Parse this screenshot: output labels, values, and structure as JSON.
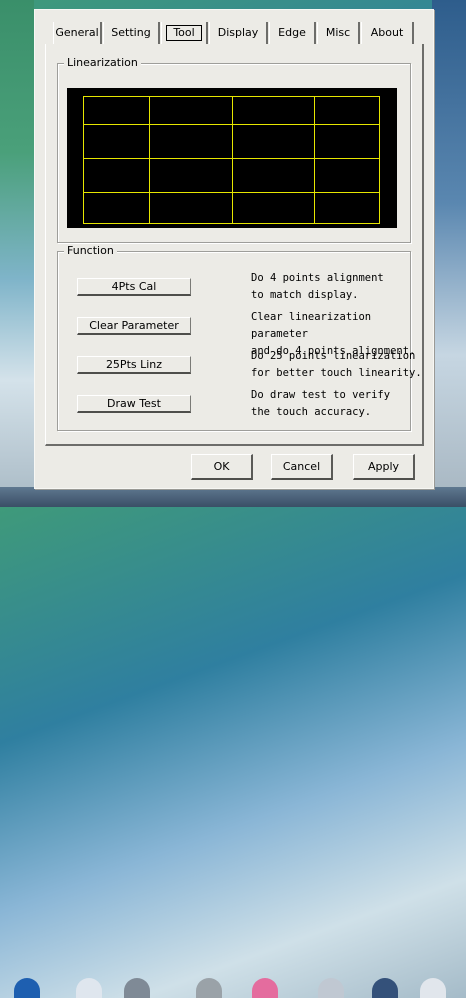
{
  "tabs": [
    {
      "label": "General"
    },
    {
      "label": "Setting"
    },
    {
      "label": "Tool"
    },
    {
      "label": "Display"
    },
    {
      "label": "Edge"
    },
    {
      "label": "Misc"
    },
    {
      "label": "About"
    }
  ],
  "active_tab": "Tool",
  "linearization": {
    "title": "Linearization",
    "grid_color": "#e6e600",
    "background_color": "#000000"
  },
  "function": {
    "title": "Function",
    "items": [
      {
        "button": "4Pts Cal",
        "line1": "Do 4 points alignment",
        "line2": "to match display."
      },
      {
        "button": "Clear Parameter",
        "line1": "Clear linearization parameter",
        "line2": "and do 4 points alignment."
      },
      {
        "button": "25Pts Linz",
        "line1": "Do 25 points linearization",
        "line2": "for better touch linearity."
      },
      {
        "button": "Draw Test",
        "line1": "Do draw test to verify",
        "line2": "the touch accuracy."
      }
    ]
  },
  "buttons": {
    "ok": "OK",
    "cancel": "Cancel",
    "apply": "Apply"
  }
}
